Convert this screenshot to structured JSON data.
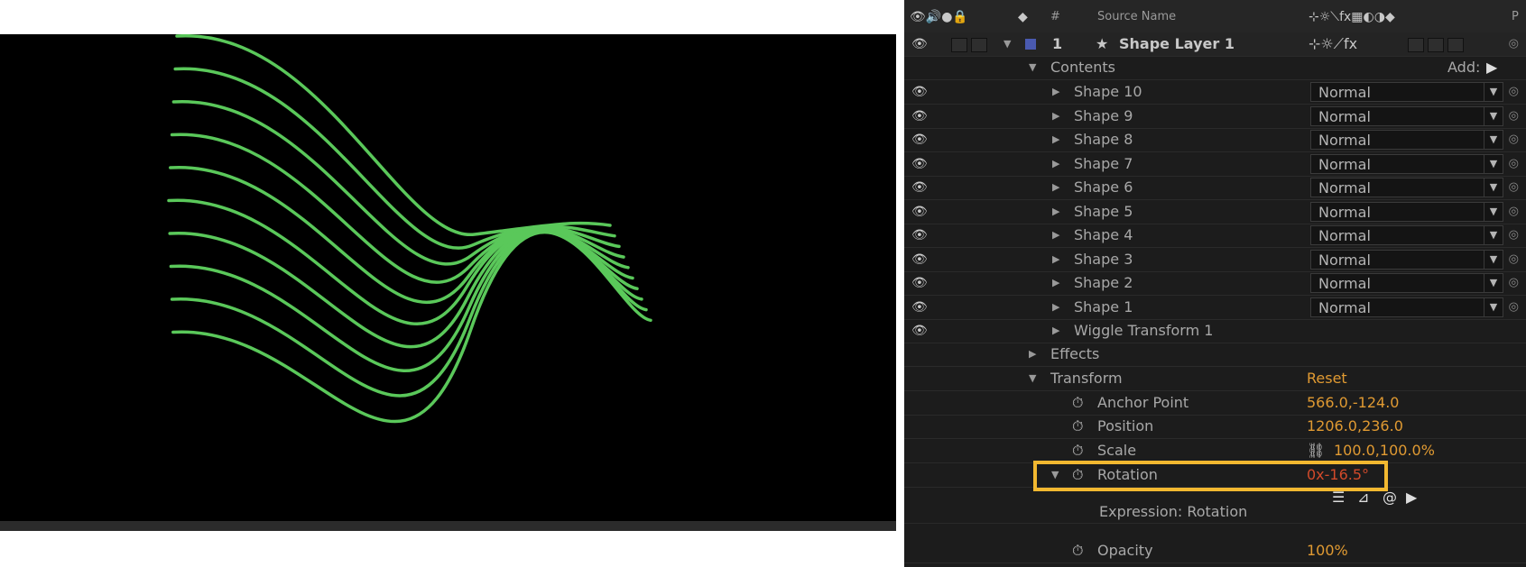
{
  "header": {
    "hash": "#",
    "source_name": "Source Name",
    "p": "P"
  },
  "layer": {
    "number": "1",
    "name": "Shape Layer 1",
    "color": "#4a5ab0"
  },
  "contents": {
    "label": "Contents",
    "add_label": "Add:",
    "shapes": [
      "Shape 10",
      "Shape 9",
      "Shape 8",
      "Shape 7",
      "Shape 6",
      "Shape 5",
      "Shape 4",
      "Shape 3",
      "Shape 2",
      "Shape 1"
    ],
    "blend_mode": "Normal",
    "wiggle": "Wiggle Transform 1"
  },
  "effects_label": "Effects",
  "transform": {
    "label": "Transform",
    "reset": "Reset",
    "anchor_point": {
      "label": "Anchor Point",
      "value": "566.0,-124.0"
    },
    "position": {
      "label": "Position",
      "value": "1206.0,236.0"
    },
    "scale": {
      "label": "Scale",
      "value": "100.0,100.0%"
    },
    "rotation": {
      "label": "Rotation",
      "value": "0x-16.5°"
    },
    "expression": {
      "label": "Expression: Rotation"
    },
    "opacity": {
      "label": "Opacity",
      "value": "100%"
    }
  },
  "colors": {
    "stroke": "#5ac85a",
    "value_orange": "#e09a32",
    "value_red": "#d24a2a",
    "highlight": "#f2b830"
  }
}
